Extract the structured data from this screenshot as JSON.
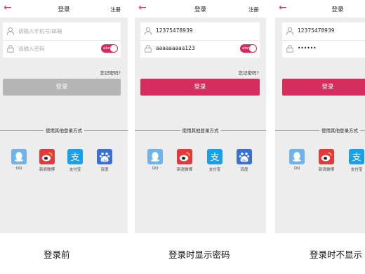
{
  "screens": [
    {
      "title": "登录",
      "register": "注册",
      "phone_placeholder": "请输入手机号/邮箱",
      "password_placeholder": "请输入密码",
      "toggle_label": "abc",
      "forgot": "忘记密码?",
      "login_button": "登录",
      "other_methods": "使用其他登录方式",
      "caption": "登录前"
    },
    {
      "title": "登录",
      "register": "注册",
      "phone_value": "12375478939",
      "password_value": "aaaaaaaaa123",
      "toggle_label": "abc",
      "forgot": "忘记密码?",
      "login_button": "登录",
      "other_methods": "使用其他登录方式",
      "caption": "登录时显示密码"
    },
    {
      "title": "登录",
      "phone_value": "12375478939",
      "password_value": "••••••",
      "login_button": "登录",
      "other_methods": "使用其他登录方式",
      "caption": "登录时不显示"
    }
  ],
  "social": [
    {
      "label": "QQ",
      "icon": "qq-icon",
      "color": "#6fb3e8"
    },
    {
      "label": "新浪微博",
      "icon": "weibo-icon",
      "color": "#e0393e"
    },
    {
      "label": "支付宝",
      "icon": "alipay-icon",
      "color": "#1aa0e8"
    },
    {
      "label": "百度",
      "icon": "baidu-icon",
      "color": "#3b6fd4"
    }
  ],
  "colors": {
    "accent": "#d62d5f",
    "disabled": "#b5b5b5",
    "background": "#ededed"
  }
}
